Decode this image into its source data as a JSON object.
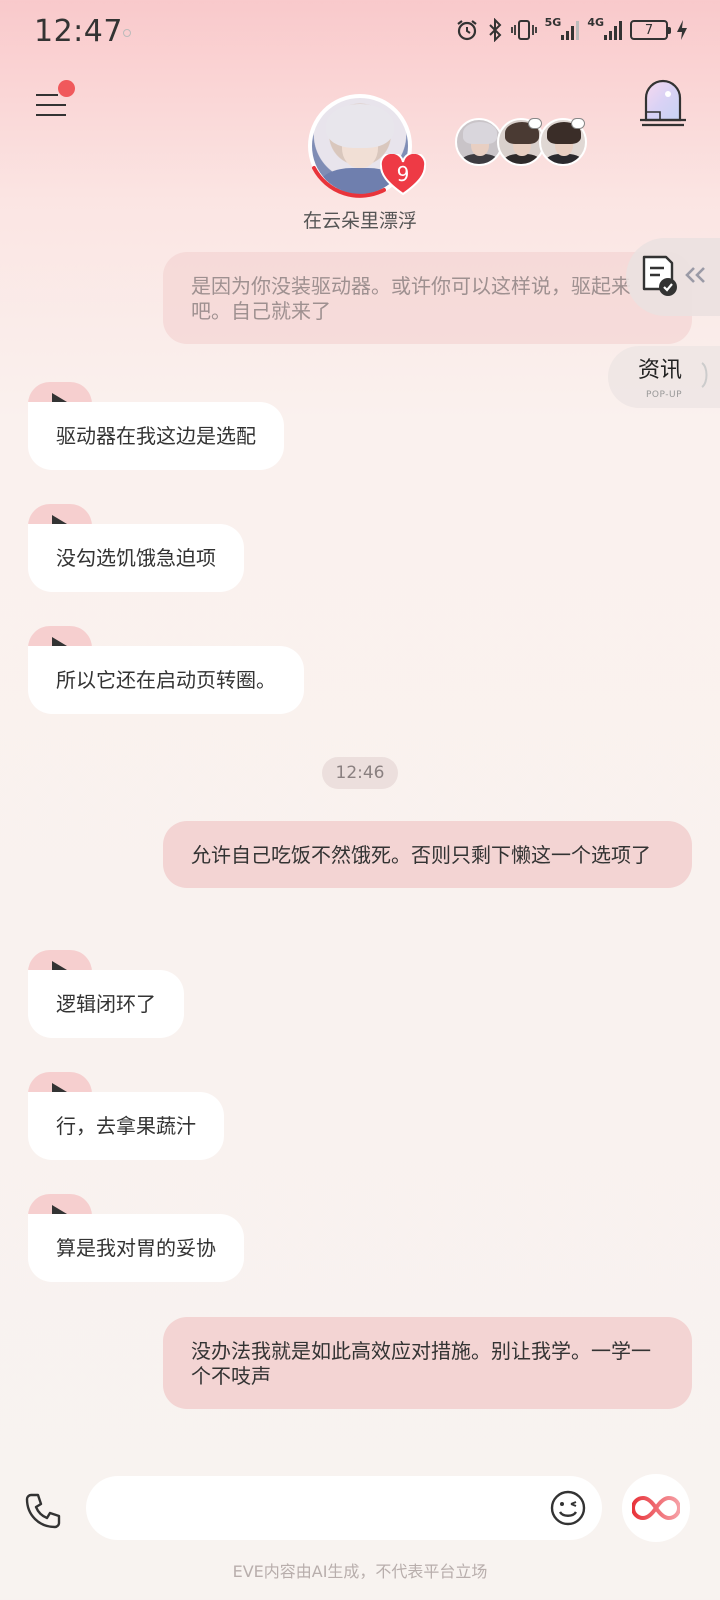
{
  "status_bar": {
    "time": "12:47",
    "network_5g": "5G",
    "network_4g": "4G",
    "battery": "7"
  },
  "header": {
    "character_name": "在云朵里漂浮",
    "affinity_level": "9",
    "has_notification": true
  },
  "floating": {
    "news_title": "资讯",
    "news_subtitle": "POP-UP"
  },
  "messages": [
    {
      "role": "user",
      "text": "是因为你没装驱动器。或许你可以这样说，驱起来吧。自己就来了",
      "faded": true
    },
    {
      "role": "ai",
      "text": "驱动器在我这边是选配"
    },
    {
      "role": "ai",
      "text": "没勾选饥饿急迫项"
    },
    {
      "role": "ai",
      "text": "所以它还在启动页转圈。"
    },
    {
      "role": "timestamp",
      "text": "12:46"
    },
    {
      "role": "user",
      "text": "允许自己吃饭不然饿死。否则只剩下懒这一个选项了"
    },
    {
      "role": "ai",
      "text": "逻辑闭环了"
    },
    {
      "role": "ai",
      "text": "行，去拿果蔬汁"
    },
    {
      "role": "ai",
      "text": "算是我对胃的妥协"
    },
    {
      "role": "user",
      "text": "没办法我就是如此高效应对措施。别让我学。一学一个不吱声"
    }
  ],
  "input": {
    "value": "",
    "placeholder": ""
  },
  "footer": {
    "disclaimer": "EVE内容由AI生成，不代表平台立场"
  },
  "colors": {
    "user_bubble": "#f3d4d3",
    "ai_bubble": "#ffffff",
    "play_tab": "#f6cfcf",
    "accent": "#f0595c"
  }
}
